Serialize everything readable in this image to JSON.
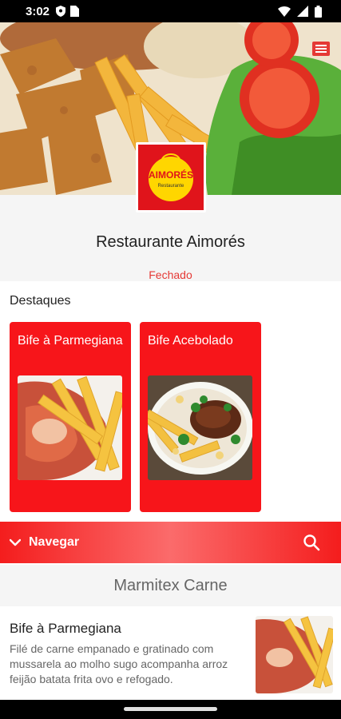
{
  "status_bar": {
    "time": "3:02",
    "left_icons": [
      "shield-icon",
      "sim-card-icon"
    ],
    "right_icons": [
      "wifi-icon",
      "signal-icon",
      "battery-icon"
    ]
  },
  "restaurant": {
    "name": "Restaurante Aimorés",
    "status": "Fechado",
    "logo": {
      "brand": "AIMORÉS",
      "subtitle": "Restaurante",
      "background": "#e0141b",
      "badge": "#ffd600"
    }
  },
  "highlights": {
    "title": "Destaques",
    "items": [
      {
        "label": "Bife à Parmegiana"
      },
      {
        "label": "Bife Acebolado"
      }
    ]
  },
  "nav": {
    "label": "Navegar",
    "icon": "chevron-down-icon",
    "search_icon": "search-icon"
  },
  "section": {
    "title": "Marmitex Carne"
  },
  "products": [
    {
      "name": "Bife à Parmegiana",
      "description": "Filé de carne empanado e gratinado com mussarela ao molho sugo acompanha arroz feijão batata frita ovo e refogado."
    }
  ],
  "colors": {
    "accent": "#f7151a",
    "status_closed": "#e53935",
    "header_bg": "#f5f5f5"
  }
}
